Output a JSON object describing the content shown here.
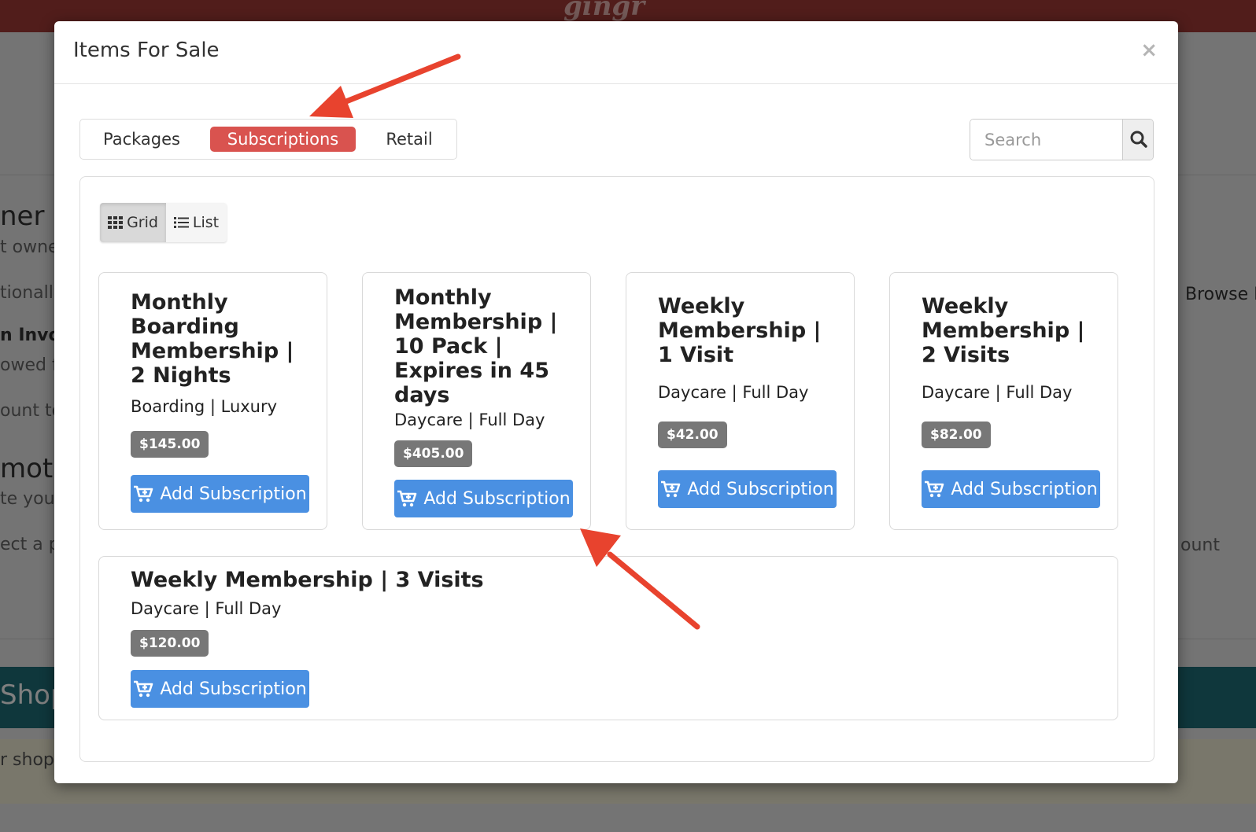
{
  "background": {
    "logo": "gingr",
    "left_texts": [
      "ner",
      "t owne",
      "tionally",
      "n Invoic",
      "owed f",
      "ount to",
      "moti",
      "te your",
      "ect a p",
      "Shop",
      "r shopp"
    ],
    "right_texts": [
      "Browse I",
      "ount"
    ]
  },
  "modal": {
    "title": "Items For Sale",
    "close_label": "×"
  },
  "tabs": [
    {
      "label": "Packages",
      "active": false
    },
    {
      "label": "Subscriptions",
      "active": true
    },
    {
      "label": "Retail",
      "active": false
    }
  ],
  "search": {
    "placeholder": "Search",
    "value": ""
  },
  "view_toggle": {
    "grid_label": "Grid",
    "list_label": "List",
    "active": "grid"
  },
  "items": [
    {
      "title": "Monthly Boarding Membership | 2 Nights",
      "category": "Boarding | Luxury",
      "price": "$145.00",
      "button_label": "Add Subscription"
    },
    {
      "title": "Monthly Membership | 10 Pack | Expires in 45 days",
      "category": "Daycare | Full Day",
      "price": "$405.00",
      "button_label": "Add Subscription"
    },
    {
      "title": "Weekly Membership | 1 Visit",
      "category": "Daycare | Full Day",
      "price": "$42.00",
      "button_label": "Add Subscription"
    },
    {
      "title": "Weekly Membership | 2 Visits",
      "category": "Daycare | Full Day",
      "price": "$82.00",
      "button_label": "Add Subscription"
    },
    {
      "title": "Weekly Membership | 3 Visits",
      "category": "Daycare | Full Day",
      "price": "$120.00",
      "button_label": "Add Subscription"
    }
  ],
  "colors": {
    "accent_tab": "#d9534f",
    "button": "#4a90e2",
    "price_badge": "#777777",
    "annotation_arrow": "#e8432e"
  }
}
